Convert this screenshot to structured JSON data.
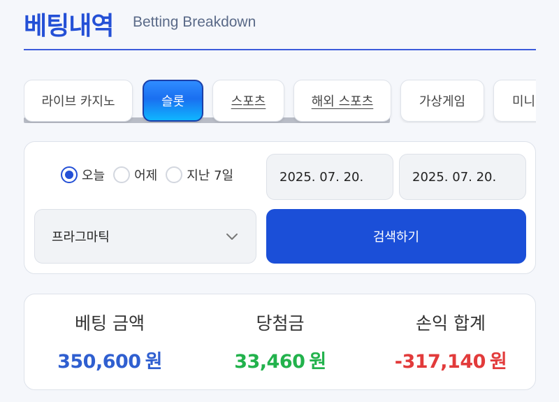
{
  "header": {
    "title": "베팅내역",
    "subtitle": "Betting Breakdown"
  },
  "tabs": [
    {
      "label": "라이브 카지노",
      "active": false
    },
    {
      "label": "슬롯",
      "active": true
    },
    {
      "label": "스포츠",
      "active": false
    },
    {
      "label": "해외 스포츠",
      "active": false
    },
    {
      "label": "가상게임",
      "active": false
    },
    {
      "label": "미니",
      "active": false
    }
  ],
  "filters": {
    "radios": [
      {
        "label": "오늘",
        "checked": true
      },
      {
        "label": "어제",
        "checked": false
      },
      {
        "label": "지난 7일",
        "checked": false
      }
    ],
    "date_start": "2025. 07. 20.",
    "date_end": "2025. 07. 20.",
    "provider_select": "프라그마틱",
    "search_label": "검색하기"
  },
  "summary": {
    "bet_amount": {
      "label": "베팅 금액",
      "value": "350,600",
      "unit": "원",
      "color": "#2f5fd0"
    },
    "winnings": {
      "label": "당첨금",
      "value": "33,460",
      "unit": "원",
      "color": "#22b24c"
    },
    "profit_loss": {
      "label": "손익 합계",
      "value": "-317,140",
      "unit": "원",
      "color": "#e23b3b"
    }
  }
}
